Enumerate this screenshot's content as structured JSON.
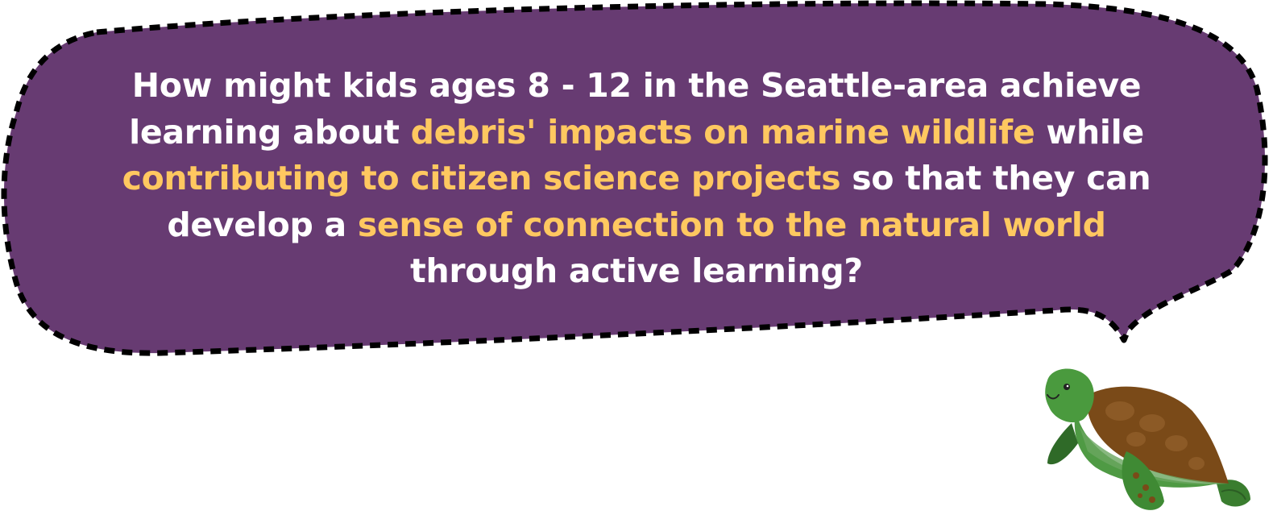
{
  "question": {
    "segments": [
      {
        "text": "How might kids ages 8 - 12 in the Seattle-area achieve learning about ",
        "highlight": false
      },
      {
        "text": "debris' impacts on marine wildlife",
        "highlight": true
      },
      {
        "text": " while ",
        "highlight": false
      },
      {
        "text": "contributing to citizen science projects",
        "highlight": true
      },
      {
        "text": " so that they can develop a ",
        "highlight": false
      },
      {
        "text": "sense of connection to the natural world",
        "highlight": true
      },
      {
        "text": " through active learning?",
        "highlight": false
      }
    ]
  },
  "colors": {
    "bubble_fill": "#673b72",
    "bubble_border": "#000000",
    "text": "#ffffff",
    "highlight": "#ffc860"
  },
  "icons": {
    "mascot": "sea-turtle-icon"
  }
}
